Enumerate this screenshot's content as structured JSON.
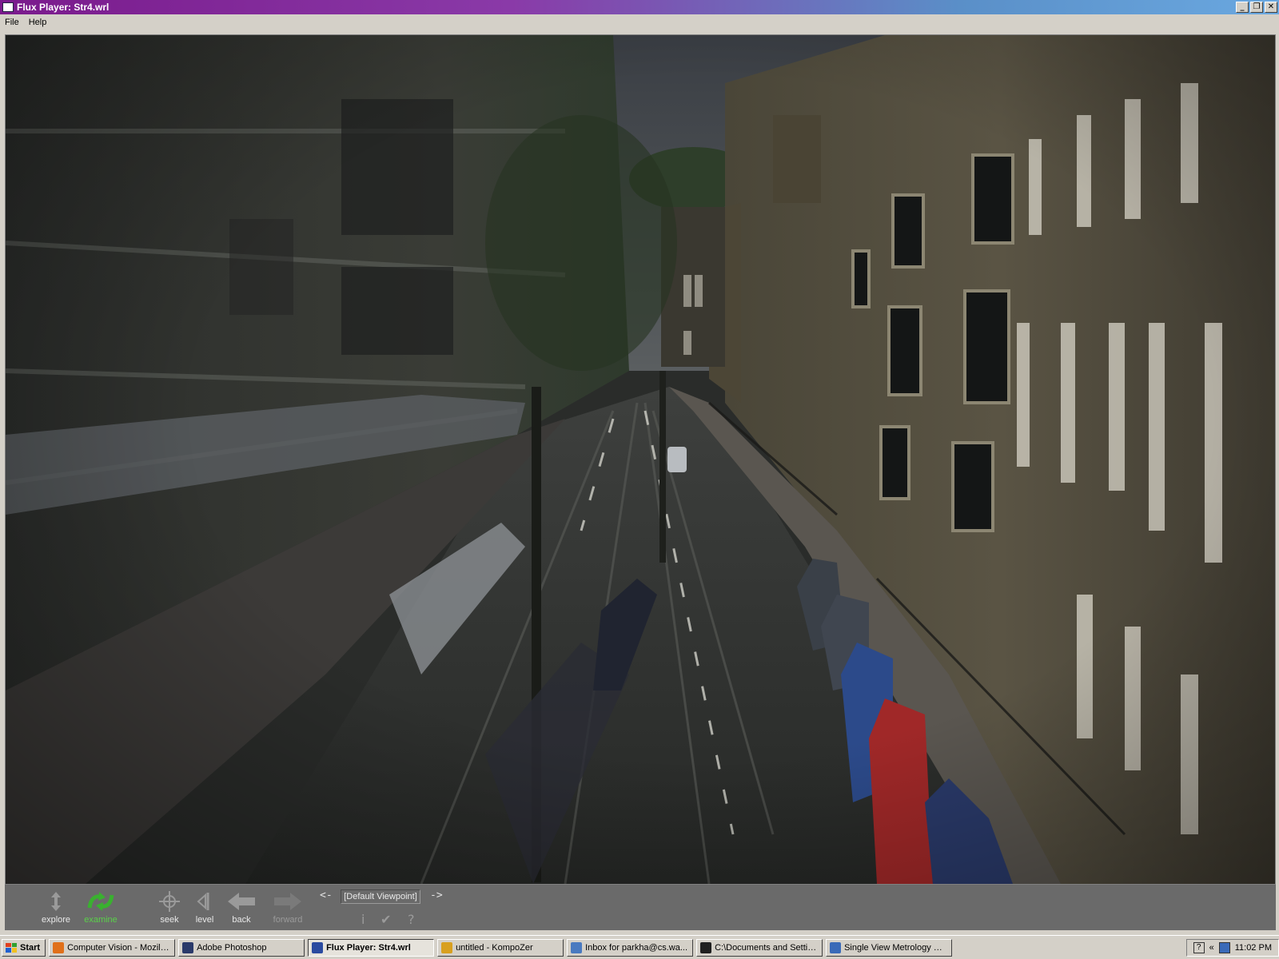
{
  "window": {
    "title": "Flux Player: Str4.wrl",
    "minimize": "_",
    "restore": "❐",
    "close": "✕"
  },
  "menu": {
    "file": "File",
    "help": "Help"
  },
  "toolbar": {
    "explore": "explore",
    "examine": "examine",
    "seek": "seek",
    "level": "level",
    "back": "back",
    "forward": "forward",
    "prev_viewpoint": "<-",
    "next_viewpoint": "->",
    "viewpoint": "[Default Viewpoint]",
    "info": "i",
    "check": "✔",
    "help": "?"
  },
  "taskbar": {
    "start": "Start",
    "tasks": [
      {
        "label": "Computer Vision - Mozilla...",
        "icon_color": "#e0701a"
      },
      {
        "label": "Adobe Photoshop",
        "icon_color": "#2a3a6a"
      },
      {
        "label": "Flux Player: Str4.wrl",
        "icon_color": "#2a4aa0"
      },
      {
        "label": "untitled - KompoZer",
        "icon_color": "#d8a020"
      },
      {
        "label": "Inbox for parkha@cs.wa...",
        "icon_color": "#4a7ac0"
      },
      {
        "label": "C:\\Documents and Settin...",
        "icon_color": "#202020"
      },
      {
        "label": "Single View Metrology Us...",
        "icon_color": "#3a6ab8"
      }
    ],
    "clock": "11:02 PM",
    "tray_help": "?",
    "tray_chevron": "«"
  }
}
